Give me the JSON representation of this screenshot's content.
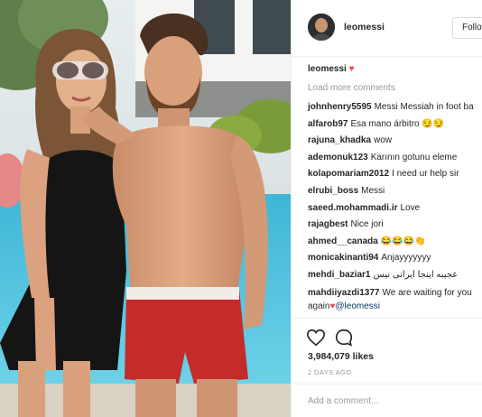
{
  "post": {
    "username": "leomessi",
    "follow_label": "Follow",
    "caption_user": "leomessi",
    "caption_heart": "♥",
    "load_more": "Load more comments",
    "comments": [
      {
        "user": "johnhenry5595",
        "text": "Messi Messiah in foot ba"
      },
      {
        "user": "alfarob97",
        "text": "Esa mano árbitro 😏😏"
      },
      {
        "user": "rajuna_khadka",
        "text": "wow"
      },
      {
        "user": "ademonuk123",
        "text": "Karının gotunu eleme"
      },
      {
        "user": "kolapomariam2012",
        "text": "I need ur help sir"
      },
      {
        "user": "elrubi_boss",
        "text": "Messi"
      },
      {
        "user": "saeed.mohammadi.ir",
        "text": "Love"
      },
      {
        "user": "rajagbest",
        "text": "Nice jori"
      },
      {
        "user": "ahmed__canada",
        "text": "😂😂😂👏"
      },
      {
        "user": "monicakinanti94",
        "text": "Anjayyyyyyy"
      },
      {
        "user": "mehdi_baziar1",
        "text": "عجیبه اینجا ایرانی نیس"
      },
      {
        "user": "mahdiiyazdi1377",
        "text": "We are waiting for you",
        "text2": "again",
        "heart": "♥",
        "mention": "@leomessi"
      }
    ],
    "likes": "3,984,079 likes",
    "time": "2 DAYS AGO",
    "add_comment_placeholder": "Add a comment...",
    "icons": {
      "like": "heart-icon",
      "comment": "comment-bubble-icon"
    }
  }
}
